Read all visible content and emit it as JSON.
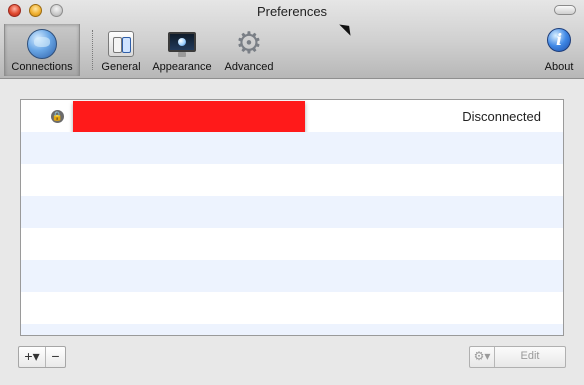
{
  "window": {
    "title": "Preferences"
  },
  "toolbar": {
    "items": [
      {
        "label": "Connections",
        "icon": "globe-icon",
        "selected": true
      },
      {
        "label": "General",
        "icon": "switches-icon",
        "selected": false
      },
      {
        "label": "Appearance",
        "icon": "monitor-icon",
        "selected": false
      },
      {
        "label": "Advanced",
        "icon": "gear-icon",
        "selected": false
      }
    ],
    "about": {
      "label": "About",
      "icon": "info-icon",
      "glyph": "i"
    }
  },
  "connections": {
    "rows": [
      {
        "status": "Disconnected",
        "name_redacted": true
      }
    ],
    "row_count_visible": 8
  },
  "footer": {
    "add_label": "+▾",
    "remove_label": "−",
    "action_icon": "gear-icon",
    "action_glyph": "⚙▾",
    "edit_label": "Edit"
  },
  "colors": {
    "row_alt": "#edf3fe",
    "redaction": "#ff1a1a"
  }
}
